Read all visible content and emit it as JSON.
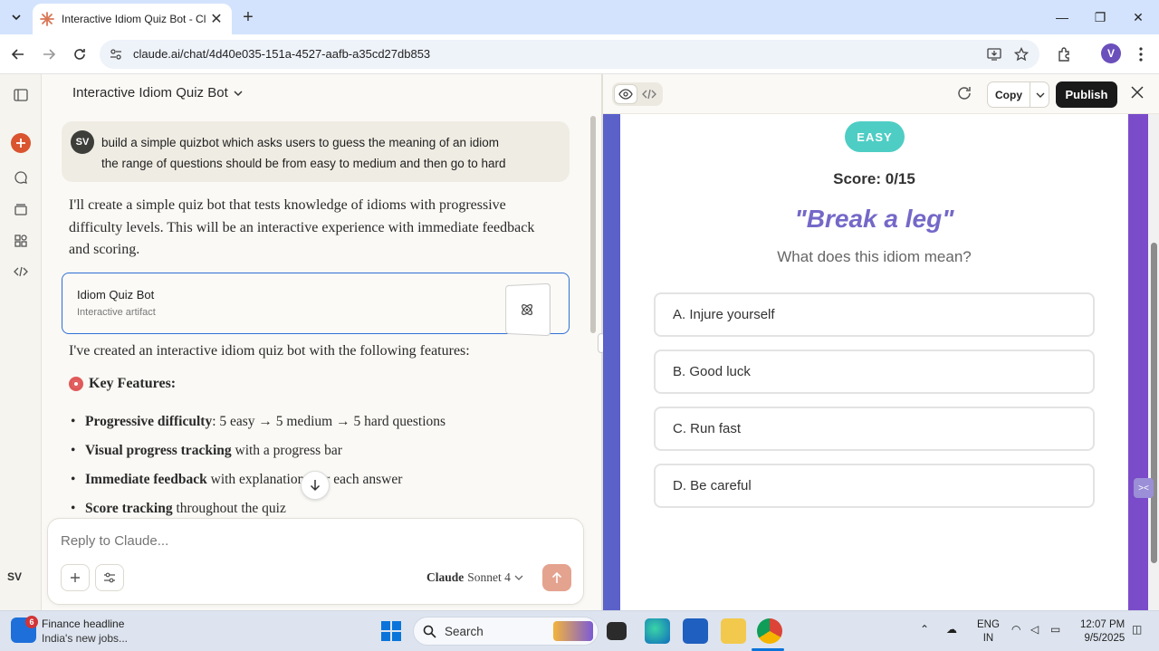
{
  "browser": {
    "tab_title": "Interactive Idiom Quiz Bot - Cla",
    "url": "claude.ai/chat/4d40e035-151a-4527-aafb-a35cd27db853",
    "profile_initial": "V"
  },
  "sidebar": {
    "user_initials": "SV"
  },
  "chat": {
    "title": "Interactive Idiom Quiz Bot",
    "user_initials": "SV",
    "user_message_line1": "build a simple quizbot which asks users to guess the meaning of an idiom",
    "user_message_line2": "the range of questions should be from easy to medium and then go to hard",
    "assistant_intro": "I'll create a simple quiz bot that tests knowledge of idioms with progressive difficulty levels. This will be an interactive experience with immediate feedback and scoring.",
    "artifact_title": "Idiom Quiz Bot",
    "artifact_subtitle": "Interactive artifact",
    "assistant_followup": "I've created an interactive idiom quiz bot with the following features:",
    "key_features_heading": "Key Features:",
    "features": [
      {
        "bold": "Progressive difficulty",
        "rest": ": 5 easy → 5 medium → 5 hard questions"
      },
      {
        "bold": "Visual progress tracking",
        "rest": " with a progress bar"
      },
      {
        "bold": "Immediate feedback",
        "rest": " with explanations for each answer"
      },
      {
        "bold": "Score tracking",
        "rest": " throughout the quiz"
      }
    ],
    "reply_placeholder": "Reply to Claude...",
    "model_name_prefix": "Claude",
    "model_name_suffix": "Sonnet 4"
  },
  "artifact_pane": {
    "copy_label": "Copy",
    "publish_label": "Publish"
  },
  "quiz": {
    "difficulty": "EASY",
    "score": "Score: 0/15",
    "idiom": "\"Break a leg\"",
    "question": "What does this idiom mean?",
    "options": [
      "A. Injure yourself",
      "B. Good luck",
      "C. Run fast",
      "D. Be careful"
    ]
  },
  "taskbar": {
    "weather_badge": "6",
    "news_headline": "Finance headline",
    "news_subline": "India's new jobs...",
    "search_label": "Search",
    "lang_line1": "ENG",
    "lang_line2": "IN",
    "time": "12:07 PM",
    "date": "9/5/2025"
  },
  "colors": {
    "accent_orange": "#d9542f",
    "quiz_purple": "#7468c8",
    "badge_teal": "#4ecdc4",
    "artifact_border": "#2f6fd6"
  }
}
